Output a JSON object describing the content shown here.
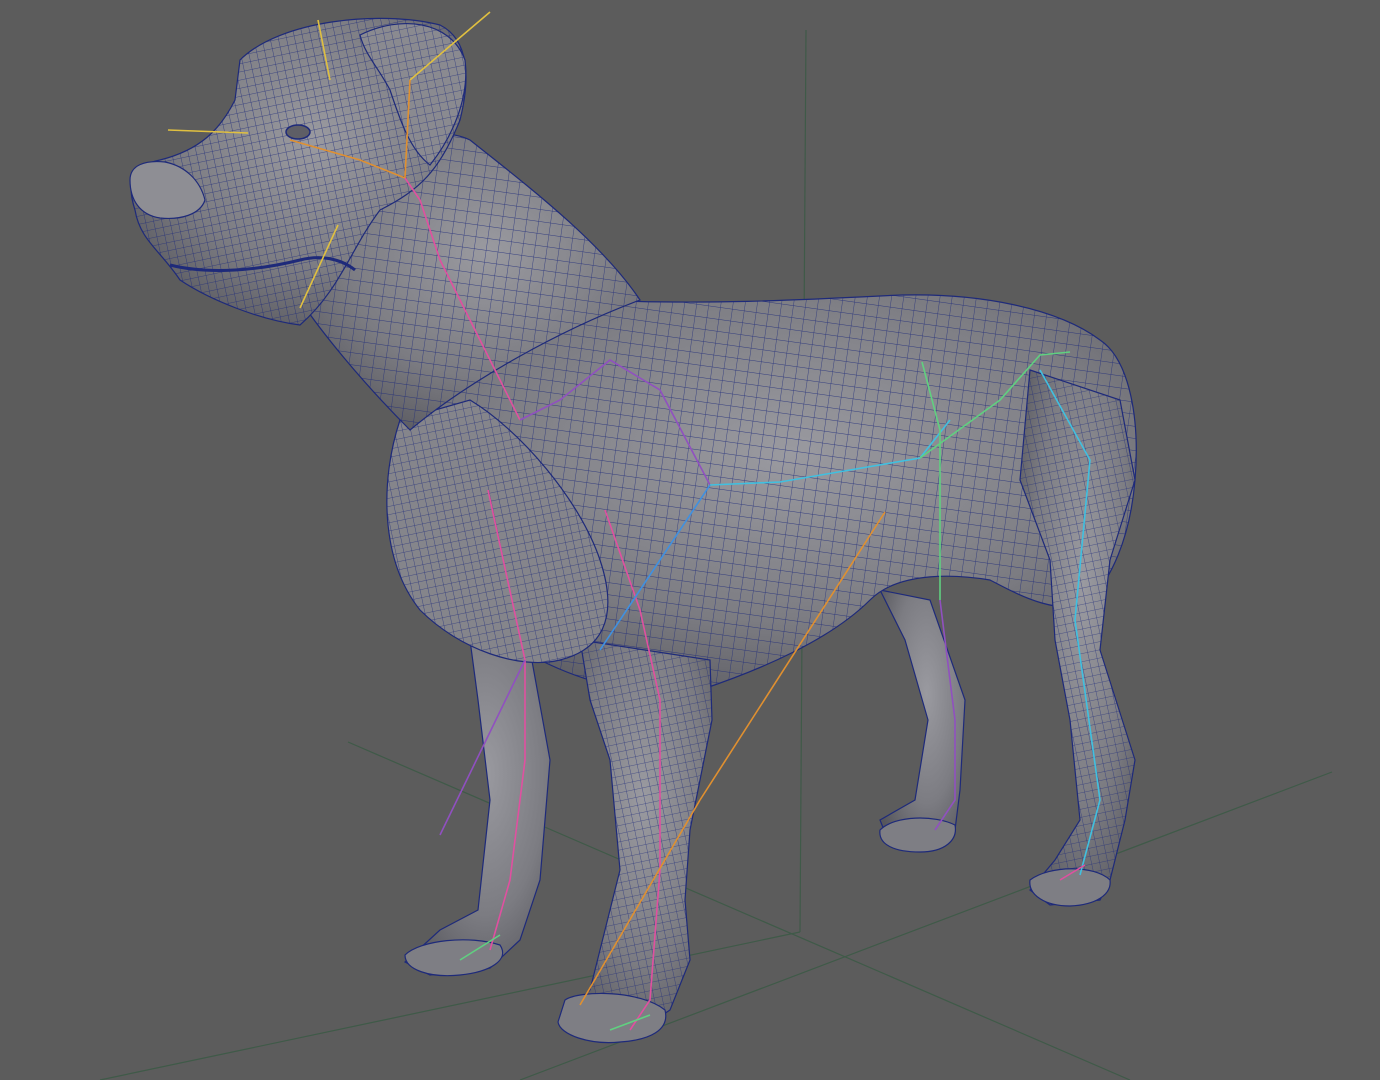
{
  "viewport": {
    "background": "#5c5c5c",
    "grid_color": "#3f5a48",
    "mesh_fill": "#7a7a7e",
    "mesh_wire": "#1e2a7a",
    "bone_colors": [
      "#e0c040",
      "#e09030",
      "#c050c0",
      "#e050a0",
      "#4090e0",
      "#40c0e0",
      "#60d080",
      "#9050c0"
    ]
  },
  "scene": {
    "object": "dog-mesh",
    "skeleton": "dog-rig"
  }
}
